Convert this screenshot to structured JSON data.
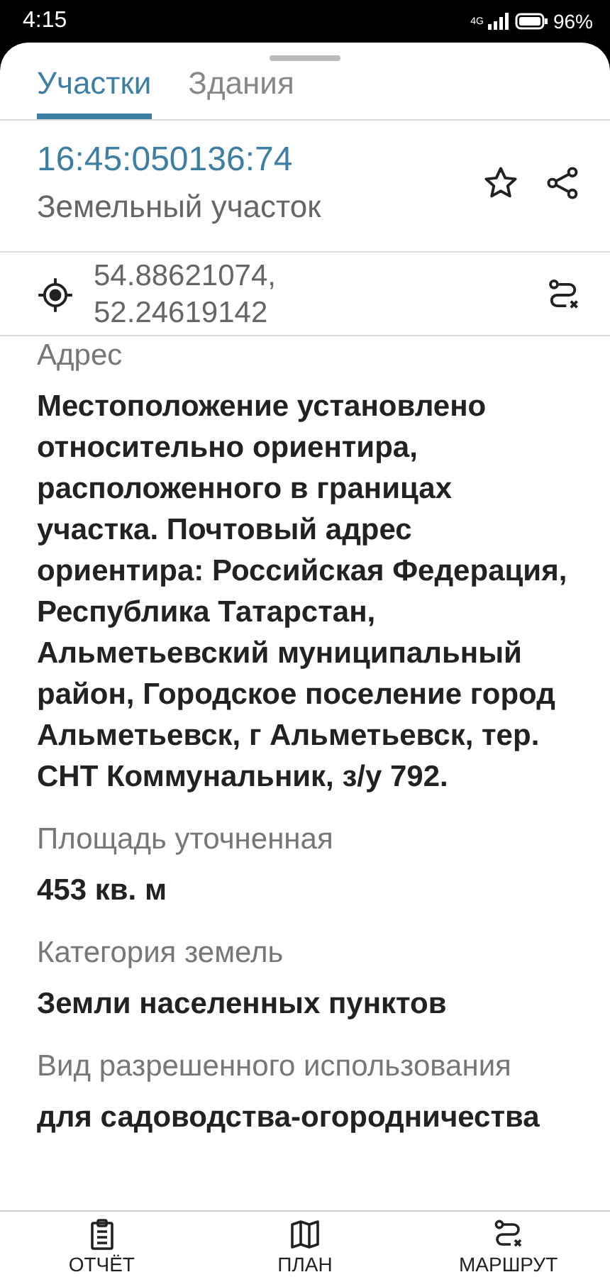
{
  "status_bar": {
    "time": "4:15",
    "network": "4G",
    "battery": "96%"
  },
  "tabs": [
    {
      "label": "Участки",
      "selected": true
    },
    {
      "label": "Здания",
      "selected": false
    }
  ],
  "parcel": {
    "number": "16:45:050136:74",
    "type": "Земельный участок",
    "favorite": false
  },
  "coordinates": {
    "lat": "54.88621074,",
    "lon": "52.24619142"
  },
  "fields": [
    {
      "label": "Адрес",
      "value": "Местоположение установлено относительно ориентира, расположенного в границах участка. Почтовый адрес ориентира: Российская Федерация, Республика Татарстан, Альметьевский муниципальный район, Городское поселение город Альметьевск, г Альметьевск, тер. СНТ Коммунальник, з/у 792."
    },
    {
      "label": "Площадь уточненная",
      "value": "453 кв. м"
    },
    {
      "label": "Категория земель",
      "value": "Земли населенных пунктов"
    },
    {
      "label": "Вид разрешенного использования",
      "value": "для садоводства-огородничества"
    }
  ],
  "bottom_nav": [
    {
      "kind": "report",
      "label": "ОТЧЁТ"
    },
    {
      "kind": "plan",
      "label": "ПЛАН"
    },
    {
      "kind": "route",
      "label": "МАРШРУТ"
    }
  ]
}
